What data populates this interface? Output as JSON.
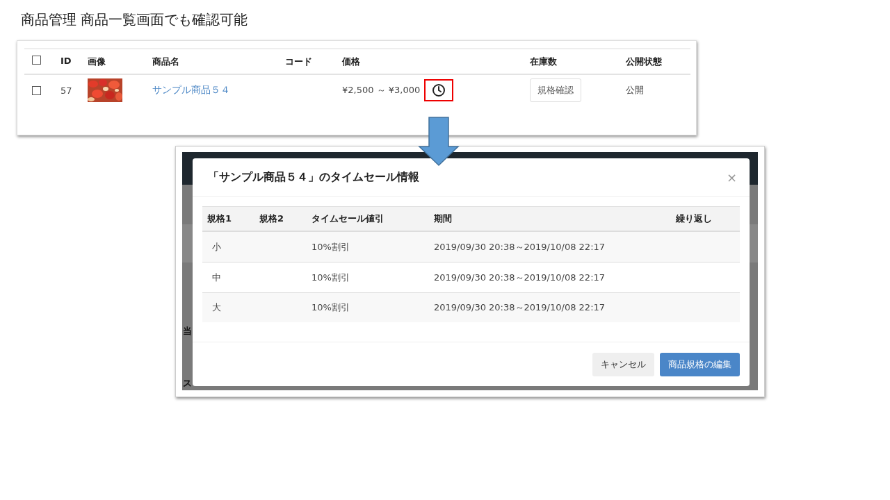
{
  "slide": {
    "title": "商品管理 商品一覧画面でも確認可能"
  },
  "product_list": {
    "select_all": {
      "checked": false
    },
    "columns": [
      "ID",
      "画像",
      "商品名",
      "コード",
      "価格",
      "在庫数",
      "公開状態"
    ],
    "rows": [
      {
        "checked": false,
        "id": "57",
        "name": "サンプル商品５４",
        "price": "¥2,500 ～ ¥3,000",
        "timesale": true,
        "highlighted": true,
        "stock_button": "規格確認",
        "status": "公開"
      }
    ]
  },
  "backdrop": {
    "texts": [
      "当",
      "ス"
    ]
  },
  "modal": {
    "title": "「サンプル商品５４」のタイムセール情報",
    "close": "×",
    "columns": [
      "規格1",
      "規格2",
      "タイムセール値引",
      "期間",
      "繰り返し"
    ],
    "rows": [
      {
        "spec1": "小",
        "discount": "10%割引",
        "period": "2019/09/30 20:38～2019/10/08 22:17"
      },
      {
        "spec1": "中",
        "discount": "10%割引",
        "period": "2019/09/30 20:38～2019/10/08 22:17"
      },
      {
        "spec1": "大",
        "discount": "10%割引",
        "period": "2019/09/30 20:38～2019/10/08 22:17"
      }
    ],
    "buttons": [
      {
        "label": "キャンセル",
        "kind": "secondary"
      },
      {
        "label": "商品規格の編集",
        "kind": "primary"
      }
    ]
  }
}
